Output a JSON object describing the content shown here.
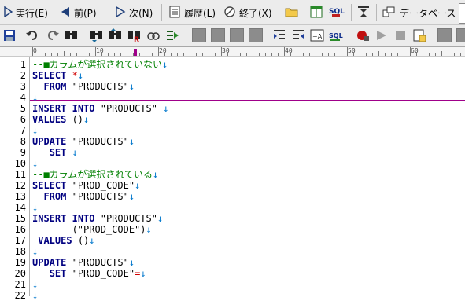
{
  "toolbar_main": {
    "run_label": "実行(E)",
    "prev_label": "前(P)",
    "next_label": "次(N)",
    "history_label": "履歴(L)",
    "exit_label": "終了(X)",
    "database_label": "データベース"
  },
  "toolbar_icons": [
    "save-icon",
    "undo-icon",
    "redo-icon",
    "find-icon",
    "find-next-icon",
    "find-prev-icon",
    "replace-icon",
    "bookmark-icon",
    "run-to-line-icon",
    "disabled-1-icon",
    "disabled-2-icon",
    "disabled-3-icon",
    "disabled-4-icon",
    "indent-icon",
    "outdent-icon",
    "format-icon",
    "sql-format-icon",
    "record-macro-icon",
    "play-macro-icon",
    "stop-macro-icon",
    "options-icon",
    "extra-icon"
  ],
  "ruler": {
    "labels": [
      "0",
      "10",
      "20",
      "30",
      "40",
      "50",
      "60"
    ]
  },
  "editor": {
    "line_numbers": [
      "1",
      "2",
      "3",
      "4",
      "5",
      "6",
      "7",
      "8",
      "9",
      "10",
      "11",
      "12",
      "13",
      "14",
      "15",
      "16",
      "17",
      "18",
      "19",
      "20",
      "21",
      "22"
    ],
    "lines": [
      "--■カラムが選択されていない↓",
      "SELECT *↓",
      "  FROM \"PRODUCTS\"↓",
      "↓",
      "INSERT INTO \"PRODUCTS\" ↓",
      "VALUES ()↓",
      "↓",
      "UPDATE \"PRODUCTS\"↓",
      "   SET ↓",
      "↓",
      "--■カラムが選択されている↓",
      "SELECT \"PROD_CODE\"↓",
      "  FROM \"PRODUCTS\"↓",
      "↓",
      "INSERT INTO \"PRODUCTS\"↓",
      "       (\"PROD_CODE\")↓",
      " VALUES ()↓",
      "↓",
      "UPDATE \"PRODUCTS\"↓",
      "   SET \"PROD_CODE\"=↓",
      "↓",
      "↓"
    ]
  },
  "colors": {
    "keyword": "#000080",
    "comment": "#008000",
    "eol_mark": "#0077cc",
    "cursor_line": "#a0008a"
  }
}
